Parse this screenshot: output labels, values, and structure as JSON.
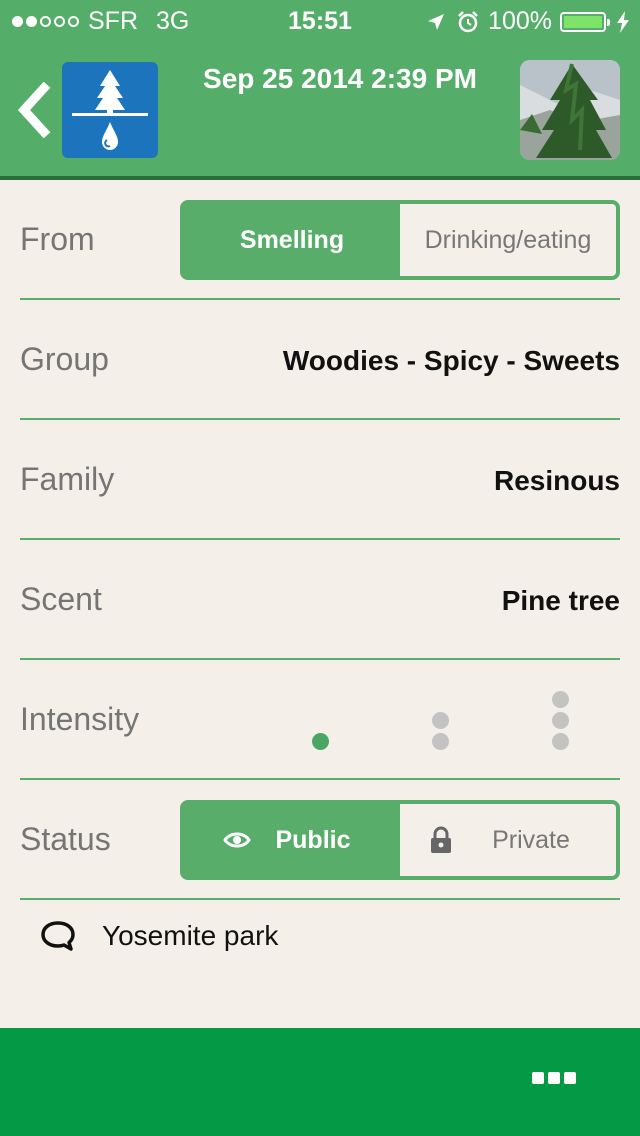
{
  "status_bar": {
    "signal_dots": [
      true,
      true,
      false,
      false,
      false
    ],
    "carrier": "SFR",
    "network": "3G",
    "time": "15:51",
    "battery_label": "100%",
    "battery_level": 1.0
  },
  "header": {
    "title": "Sep 25 2014 2:39 PM",
    "back_icon": "chevron-left-icon",
    "logo_icon": "tree-drop-icon",
    "background": "#54ad68"
  },
  "form": {
    "from": {
      "label": "From",
      "options": [
        "Smelling",
        "Drinking/eating"
      ],
      "selected": "Smelling"
    },
    "group": {
      "label": "Group",
      "value": "Woodies - Spicy - Sweets"
    },
    "family": {
      "label": "Family",
      "value": "Resinous"
    },
    "scent": {
      "label": "Scent",
      "value": "Pine tree"
    },
    "intensity": {
      "label": "Intensity",
      "levels": 3,
      "selected": 1
    },
    "status": {
      "label": "Status",
      "public_label": "Public",
      "private_label": "Private",
      "selected": "Public",
      "public_icon": "eye-icon",
      "private_icon": "lock-icon"
    }
  },
  "comment": {
    "icon": "speech-bubble-icon",
    "text": "Yosemite park"
  },
  "footer": {
    "more_icon": "more-dots-icon",
    "background": "#049a45"
  },
  "colors": {
    "accent": "#58ad6a",
    "background": "#f5efe9",
    "label": "#757575"
  }
}
